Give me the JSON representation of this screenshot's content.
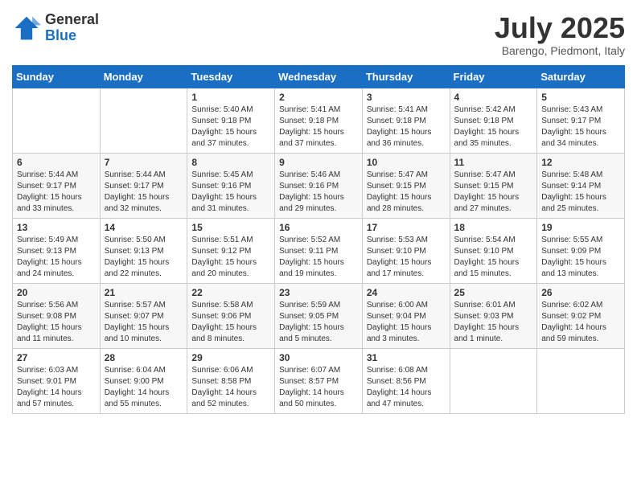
{
  "header": {
    "logo_line1": "General",
    "logo_line2": "Blue",
    "month_year": "July 2025",
    "location": "Barengo, Piedmont, Italy"
  },
  "weekdays": [
    "Sunday",
    "Monday",
    "Tuesday",
    "Wednesday",
    "Thursday",
    "Friday",
    "Saturday"
  ],
  "weeks": [
    [
      {
        "day": "",
        "detail": ""
      },
      {
        "day": "",
        "detail": ""
      },
      {
        "day": "1",
        "detail": "Sunrise: 5:40 AM\nSunset: 9:18 PM\nDaylight: 15 hours\nand 37 minutes."
      },
      {
        "day": "2",
        "detail": "Sunrise: 5:41 AM\nSunset: 9:18 PM\nDaylight: 15 hours\nand 37 minutes."
      },
      {
        "day": "3",
        "detail": "Sunrise: 5:41 AM\nSunset: 9:18 PM\nDaylight: 15 hours\nand 36 minutes."
      },
      {
        "day": "4",
        "detail": "Sunrise: 5:42 AM\nSunset: 9:18 PM\nDaylight: 15 hours\nand 35 minutes."
      },
      {
        "day": "5",
        "detail": "Sunrise: 5:43 AM\nSunset: 9:17 PM\nDaylight: 15 hours\nand 34 minutes."
      }
    ],
    [
      {
        "day": "6",
        "detail": "Sunrise: 5:44 AM\nSunset: 9:17 PM\nDaylight: 15 hours\nand 33 minutes."
      },
      {
        "day": "7",
        "detail": "Sunrise: 5:44 AM\nSunset: 9:17 PM\nDaylight: 15 hours\nand 32 minutes."
      },
      {
        "day": "8",
        "detail": "Sunrise: 5:45 AM\nSunset: 9:16 PM\nDaylight: 15 hours\nand 31 minutes."
      },
      {
        "day": "9",
        "detail": "Sunrise: 5:46 AM\nSunset: 9:16 PM\nDaylight: 15 hours\nand 29 minutes."
      },
      {
        "day": "10",
        "detail": "Sunrise: 5:47 AM\nSunset: 9:15 PM\nDaylight: 15 hours\nand 28 minutes."
      },
      {
        "day": "11",
        "detail": "Sunrise: 5:47 AM\nSunset: 9:15 PM\nDaylight: 15 hours\nand 27 minutes."
      },
      {
        "day": "12",
        "detail": "Sunrise: 5:48 AM\nSunset: 9:14 PM\nDaylight: 15 hours\nand 25 minutes."
      }
    ],
    [
      {
        "day": "13",
        "detail": "Sunrise: 5:49 AM\nSunset: 9:13 PM\nDaylight: 15 hours\nand 24 minutes."
      },
      {
        "day": "14",
        "detail": "Sunrise: 5:50 AM\nSunset: 9:13 PM\nDaylight: 15 hours\nand 22 minutes."
      },
      {
        "day": "15",
        "detail": "Sunrise: 5:51 AM\nSunset: 9:12 PM\nDaylight: 15 hours\nand 20 minutes."
      },
      {
        "day": "16",
        "detail": "Sunrise: 5:52 AM\nSunset: 9:11 PM\nDaylight: 15 hours\nand 19 minutes."
      },
      {
        "day": "17",
        "detail": "Sunrise: 5:53 AM\nSunset: 9:10 PM\nDaylight: 15 hours\nand 17 minutes."
      },
      {
        "day": "18",
        "detail": "Sunrise: 5:54 AM\nSunset: 9:10 PM\nDaylight: 15 hours\nand 15 minutes."
      },
      {
        "day": "19",
        "detail": "Sunrise: 5:55 AM\nSunset: 9:09 PM\nDaylight: 15 hours\nand 13 minutes."
      }
    ],
    [
      {
        "day": "20",
        "detail": "Sunrise: 5:56 AM\nSunset: 9:08 PM\nDaylight: 15 hours\nand 11 minutes."
      },
      {
        "day": "21",
        "detail": "Sunrise: 5:57 AM\nSunset: 9:07 PM\nDaylight: 15 hours\nand 10 minutes."
      },
      {
        "day": "22",
        "detail": "Sunrise: 5:58 AM\nSunset: 9:06 PM\nDaylight: 15 hours\nand 8 minutes."
      },
      {
        "day": "23",
        "detail": "Sunrise: 5:59 AM\nSunset: 9:05 PM\nDaylight: 15 hours\nand 5 minutes."
      },
      {
        "day": "24",
        "detail": "Sunrise: 6:00 AM\nSunset: 9:04 PM\nDaylight: 15 hours\nand 3 minutes."
      },
      {
        "day": "25",
        "detail": "Sunrise: 6:01 AM\nSunset: 9:03 PM\nDaylight: 15 hours\nand 1 minute."
      },
      {
        "day": "26",
        "detail": "Sunrise: 6:02 AM\nSunset: 9:02 PM\nDaylight: 14 hours\nand 59 minutes."
      }
    ],
    [
      {
        "day": "27",
        "detail": "Sunrise: 6:03 AM\nSunset: 9:01 PM\nDaylight: 14 hours\nand 57 minutes."
      },
      {
        "day": "28",
        "detail": "Sunrise: 6:04 AM\nSunset: 9:00 PM\nDaylight: 14 hours\nand 55 minutes."
      },
      {
        "day": "29",
        "detail": "Sunrise: 6:06 AM\nSunset: 8:58 PM\nDaylight: 14 hours\nand 52 minutes."
      },
      {
        "day": "30",
        "detail": "Sunrise: 6:07 AM\nSunset: 8:57 PM\nDaylight: 14 hours\nand 50 minutes."
      },
      {
        "day": "31",
        "detail": "Sunrise: 6:08 AM\nSunset: 8:56 PM\nDaylight: 14 hours\nand 47 minutes."
      },
      {
        "day": "",
        "detail": ""
      },
      {
        "day": "",
        "detail": ""
      }
    ]
  ]
}
